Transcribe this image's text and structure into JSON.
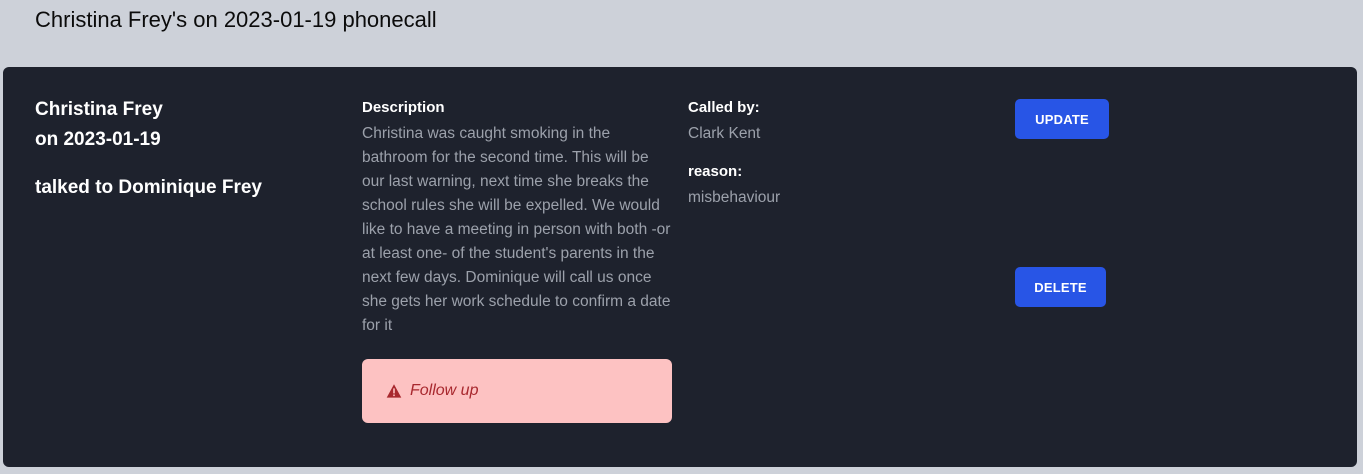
{
  "page": {
    "title": "Christina Frey's on 2023-01-19 phonecall"
  },
  "card": {
    "student_name": "Christina Frey",
    "date_line": "on 2023-01-19",
    "talked_to": "talked to Dominique Frey",
    "description_label": "Description",
    "description_text": "Christina was caught smoking in the bathroom for the second time. This will be our last warning, next time she breaks the school rules she will be expelled. We would like to have a meeting in person with both -or at least one- of the student's parents in the next few days. Dominique will call us once she gets her work schedule to confirm a date for it",
    "called_by_label": "Called by:",
    "called_by_value": "Clark Kent",
    "reason_label": "reason:",
    "reason_value": "misbehaviour",
    "followup": {
      "icon": "warning-icon",
      "text": "Follow up",
      "bg_color": "#fdc2c2",
      "text_color": "#a8282e"
    },
    "update_label": "UPDATE",
    "delete_label": "DELETE"
  },
  "colors": {
    "page_bg": "#cdd1d9",
    "card_bg": "#1e222d",
    "accent": "#2855e6",
    "muted_text": "#9ca1ab"
  }
}
